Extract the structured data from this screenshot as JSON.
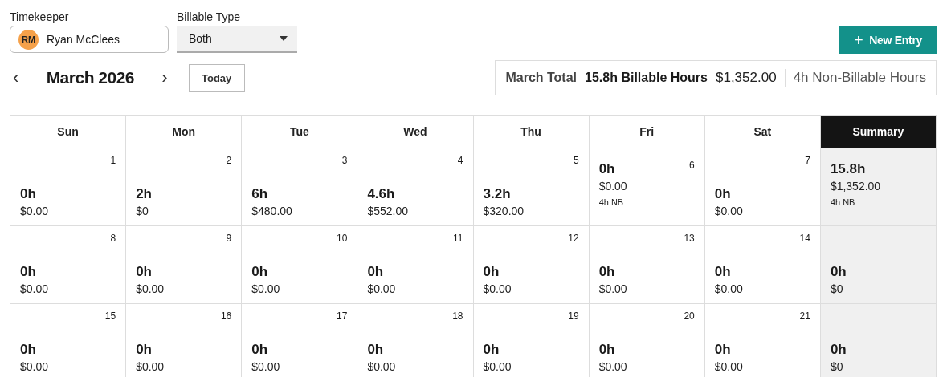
{
  "filters": {
    "timekeeper": {
      "label": "Timekeeper",
      "initials": "RM",
      "value": "Ryan McClees"
    },
    "billable_type": {
      "label": "Billable Type",
      "value": "Both"
    }
  },
  "new_entry_button": {
    "icon": "+",
    "label": "New Entry"
  },
  "nav": {
    "prev": "‹",
    "month": "March 2026",
    "next": "›",
    "today": "Today"
  },
  "month_total": {
    "label": "March Total",
    "billable": "15.8h Billable Hours",
    "amount": "$1,352.00",
    "non_billable": "4h Non-Billable Hours"
  },
  "calendar": {
    "columns": [
      {
        "label": "Sun",
        "selected": false
      },
      {
        "label": "Mon",
        "selected": false
      },
      {
        "label": "Tue",
        "selected": false
      },
      {
        "label": "Wed",
        "selected": false
      },
      {
        "label": "Thu",
        "selected": false
      },
      {
        "label": "Fri",
        "selected": false
      },
      {
        "label": "Sat",
        "selected": false
      },
      {
        "label": "Summary",
        "selected": true
      }
    ],
    "weeks": [
      {
        "days": [
          {
            "day": "1",
            "hours": "0h",
            "amount": "$0.00"
          },
          {
            "day": "2",
            "hours": "2h",
            "amount": "$0"
          },
          {
            "day": "3",
            "hours": "6h",
            "amount": "$480.00"
          },
          {
            "day": "4",
            "hours": "4.6h",
            "amount": "$552.00"
          },
          {
            "day": "5",
            "hours": "3.2h",
            "amount": "$320.00"
          },
          {
            "day": "6",
            "hours": "0h",
            "amount": "$0.00",
            "nb": "4h NB"
          },
          {
            "day": "7",
            "hours": "0h",
            "amount": "$0.00"
          }
        ],
        "summary": {
          "hours": "15.8h",
          "amount": "$1,352.00",
          "nb": "4h NB"
        }
      },
      {
        "days": [
          {
            "day": "8",
            "hours": "0h",
            "amount": "$0.00"
          },
          {
            "day": "9",
            "hours": "0h",
            "amount": "$0.00"
          },
          {
            "day": "10",
            "hours": "0h",
            "amount": "$0.00"
          },
          {
            "day": "11",
            "hours": "0h",
            "amount": "$0.00"
          },
          {
            "day": "12",
            "hours": "0h",
            "amount": "$0.00"
          },
          {
            "day": "13",
            "hours": "0h",
            "amount": "$0.00"
          },
          {
            "day": "14",
            "hours": "0h",
            "amount": "$0.00"
          }
        ],
        "summary": {
          "hours": "0h",
          "amount": "$0"
        }
      },
      {
        "days": [
          {
            "day": "15",
            "hours": "0h",
            "amount": "$0.00"
          },
          {
            "day": "16",
            "hours": "0h",
            "amount": "$0.00"
          },
          {
            "day": "17",
            "hours": "0h",
            "amount": "$0.00"
          },
          {
            "day": "18",
            "hours": "0h",
            "amount": "$0.00"
          },
          {
            "day": "19",
            "hours": "0h",
            "amount": "$0.00"
          },
          {
            "day": "20",
            "hours": "0h",
            "amount": "$0.00"
          },
          {
            "day": "21",
            "hours": "0h",
            "amount": "$0.00"
          }
        ],
        "summary": {
          "hours": "0h",
          "amount": "$0"
        }
      }
    ]
  }
}
